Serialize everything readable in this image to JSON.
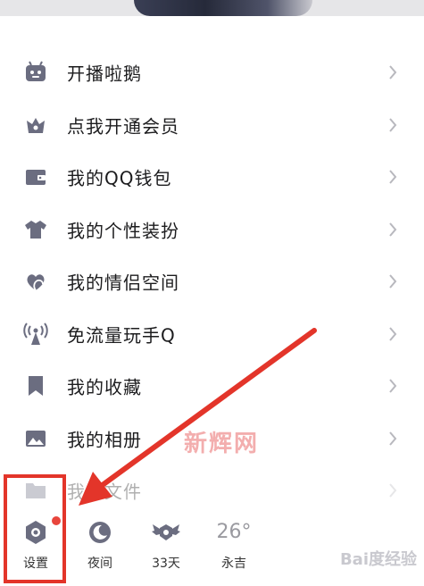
{
  "menu": {
    "items": [
      {
        "label": "开播啦鹅",
        "icon": "live-tv-icon"
      },
      {
        "label": "点我开通会员",
        "icon": "vip-crown-icon"
      },
      {
        "label": "我的QQ钱包",
        "icon": "wallet-icon"
      },
      {
        "label": "我的个性装扮",
        "icon": "tshirt-icon"
      },
      {
        "label": "我的情侣空间",
        "icon": "couple-heart-icon"
      },
      {
        "label": "免流量玩手Q",
        "icon": "signal-tower-icon"
      },
      {
        "label": "我的收藏",
        "icon": "bookmark-icon"
      },
      {
        "label": "我的相册",
        "icon": "photo-album-icon"
      },
      {
        "label": "我的文件",
        "icon": "folder-icon"
      }
    ]
  },
  "bottom_bar": {
    "settings_label": "设置",
    "night_label": "夜间",
    "days_label": "33天",
    "temperature": "26°",
    "city": "永吉"
  },
  "watermark": {
    "site": "新辉网",
    "baidu": "Bai度经验"
  },
  "colors": {
    "icon_gray": "#6b6d80",
    "annotation_red": "#e3352a",
    "badge_red": "#e8453c"
  }
}
